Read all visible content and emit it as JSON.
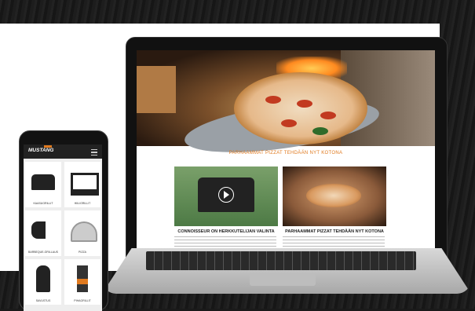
{
  "laptop": {
    "section_heading": "PARHAAMMAT PIZZAT TEHDÄÄN NYT KOTONA",
    "cards": [
      {
        "title": "CONNOISSEUR ON HERKKUTELIJAN VALINTA"
      },
      {
        "title": "PARHAAMMAT PIZZAT TEHDÄÄN NYT KOTONA"
      }
    ]
  },
  "phone": {
    "brand": "MUSTANG",
    "tiles": [
      {
        "label": "KAASUGRILLIT",
        "icon": "gas-grill-icon"
      },
      {
        "label": "HIILIGRILLIT",
        "icon": "charcoal-grill-icon"
      },
      {
        "label": "BARBEQUE-GRILLAUS",
        "icon": "smoker-grill-icon"
      },
      {
        "label": "PIZZA",
        "icon": "pizza-oven-icon"
      },
      {
        "label": "SAVUSTUS",
        "icon": "smoker-icon"
      },
      {
        "label": "PIHAGRILLIT",
        "icon": "firepit-icon"
      }
    ]
  },
  "colors": {
    "accent": "#e07a1f",
    "header": "#222222"
  }
}
